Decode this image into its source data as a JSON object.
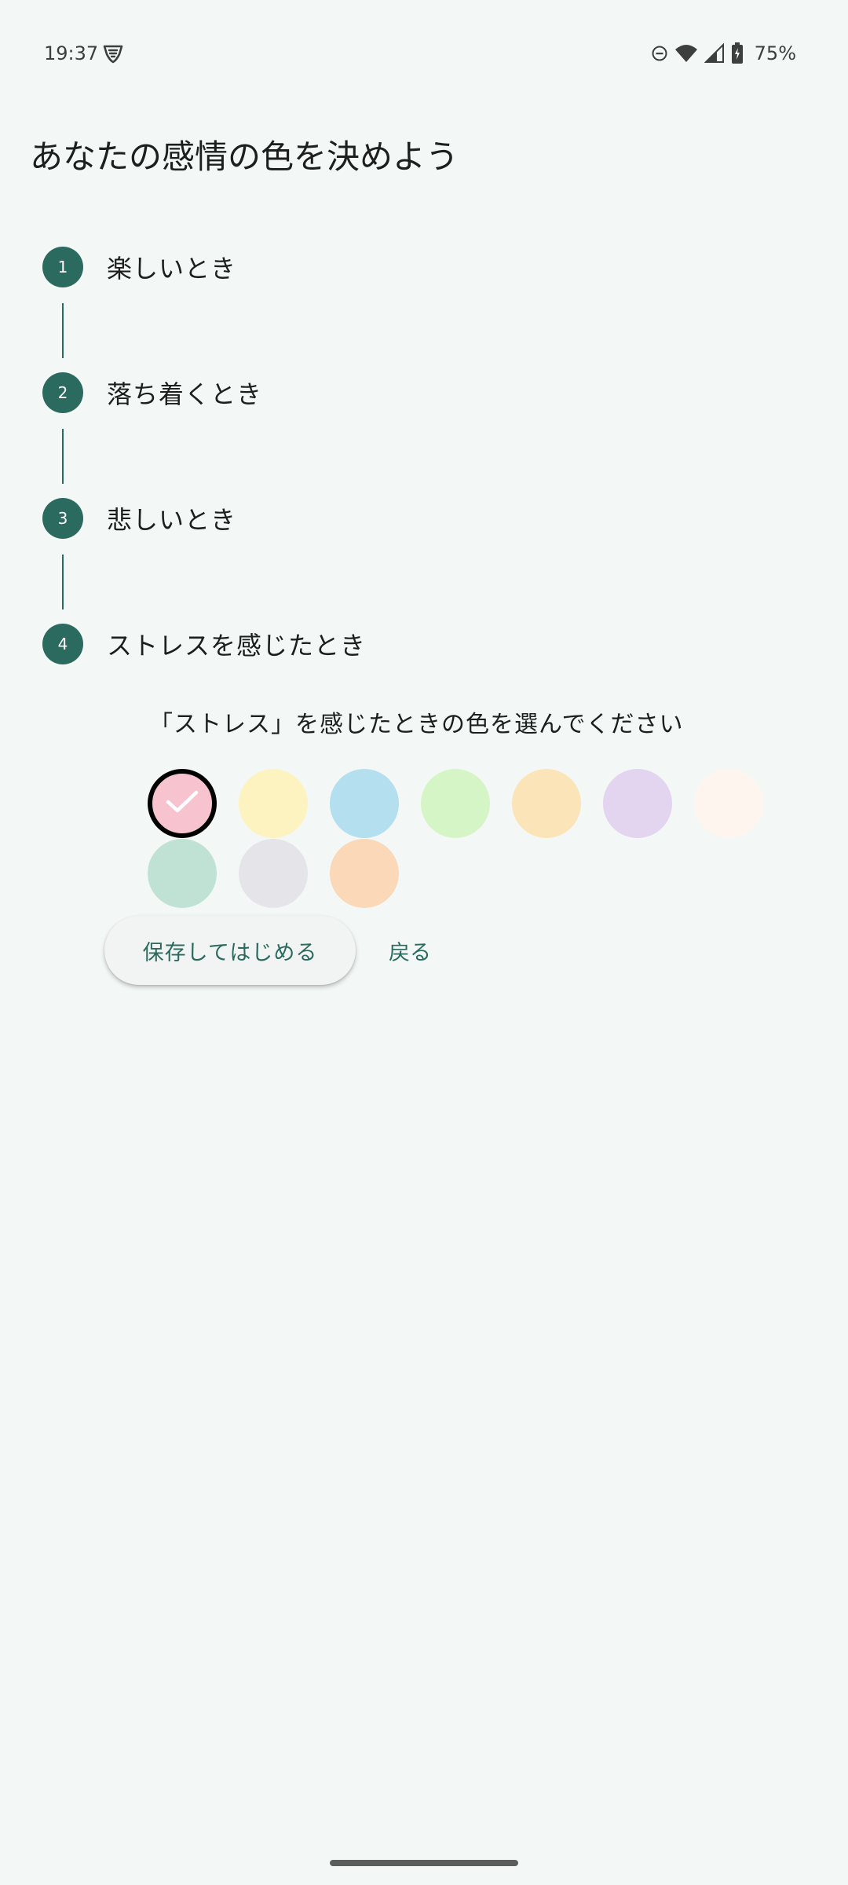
{
  "status_bar": {
    "time": "19:37",
    "battery_text": "75%",
    "icons": [
      "shield-app-icon",
      "do-not-disturb-icon",
      "wifi-icon",
      "cell-signal-icon",
      "battery-charging-icon"
    ]
  },
  "page": {
    "title": "あなたの感情の色を決めよう"
  },
  "steps": [
    {
      "number": "1",
      "label": "楽しいとき"
    },
    {
      "number": "2",
      "label": "落ち着くとき"
    },
    {
      "number": "3",
      "label": "悲しいとき"
    },
    {
      "number": "4",
      "label": "ストレスを感じたとき"
    }
  ],
  "color_picker": {
    "prompt": "「ストレス」を感じたときの色を選んでください",
    "colors": [
      "#f7c3cf",
      "#fdf3c1",
      "#b3dfee",
      "#d6f5c7",
      "#fae4b8",
      "#e3d4ef",
      "#fdf5ee",
      "#bfe2d4",
      "#e5e5e9",
      "#fad8b8"
    ],
    "selected_index": 0
  },
  "actions": {
    "save_label": "保存してはじめる",
    "back_label": "戻る"
  },
  "colors": {
    "accent": "#2b6a5e",
    "background": "#f3f8f6"
  }
}
